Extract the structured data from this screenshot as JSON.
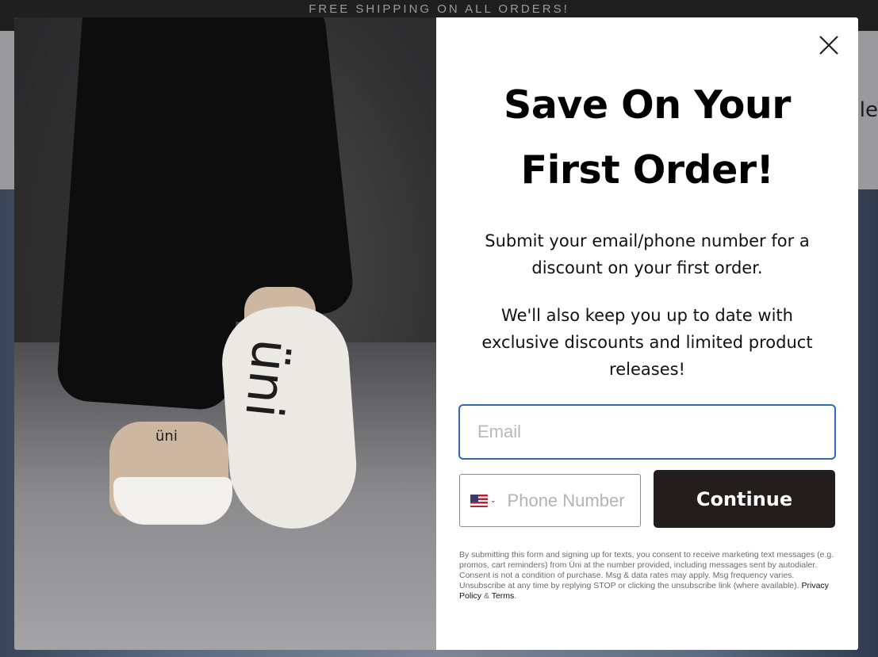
{
  "announcement": {
    "text": "FREE SHIPPING ON ALL ORDERS!"
  },
  "background": {
    "partial_text": "le"
  },
  "modal": {
    "image": {
      "sole_logo": "üni",
      "heel_logo": "üni"
    },
    "close_label": "Close",
    "title_line1": "Save On Your",
    "title_line2": "First Order!",
    "paragraph1": "Submit your email/phone number for a discount on your first order.",
    "paragraph2": "We'll also keep you up to date with exclusive discounts and limited product releases!",
    "email": {
      "value": "",
      "placeholder": "Email"
    },
    "phone": {
      "value": "",
      "placeholder": "Phone Number",
      "country_flag": "us-flag-icon"
    },
    "continue_label": "Continue",
    "legal": {
      "text": "By submitting this form and signing up for texts, you consent to receive marketing text messages (e.g. promos, cart reminders) from Üni at the number provided, including messages sent by autodialer. Consent is not a condition of purchase. Msg & data rates may apply. Msg frequency varies. Unsubscribe at any time by replying STOP or clicking the unsubscribe link (where available).",
      "privacy_label": "Privacy Policy",
      "amp": "&",
      "terms_label": "Terms",
      "end": "."
    }
  },
  "colors": {
    "accent": "#2e6ab8",
    "button": "#231d1b"
  }
}
